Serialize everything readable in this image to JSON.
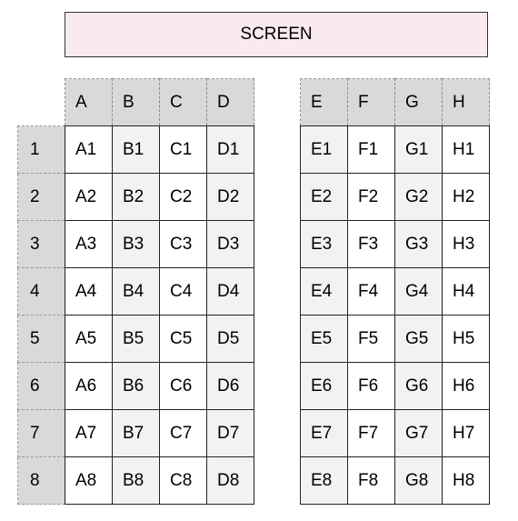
{
  "screen_label": "SCREEN",
  "rows": [
    "1",
    "2",
    "3",
    "4",
    "5",
    "6",
    "7",
    "8"
  ],
  "left_block": {
    "columns": [
      "A",
      "B",
      "C",
      "D"
    ],
    "seats": [
      [
        "A1",
        "B1",
        "C1",
        "D1"
      ],
      [
        "A2",
        "B2",
        "C2",
        "D2"
      ],
      [
        "A3",
        "B3",
        "C3",
        "D3"
      ],
      [
        "A4",
        "B4",
        "C4",
        "D4"
      ],
      [
        "A5",
        "B5",
        "C5",
        "D5"
      ],
      [
        "A6",
        "B6",
        "C6",
        "D6"
      ],
      [
        "A7",
        "B7",
        "C7",
        "D7"
      ],
      [
        "A8",
        "B8",
        "C8",
        "D8"
      ]
    ]
  },
  "right_block": {
    "columns": [
      "E",
      "F",
      "G",
      "H"
    ],
    "seats": [
      [
        "E1",
        "F1",
        "G1",
        "H1"
      ],
      [
        "E2",
        "F2",
        "G2",
        "H2"
      ],
      [
        "E3",
        "F3",
        "G3",
        "H3"
      ],
      [
        "E4",
        "F4",
        "G4",
        "H4"
      ],
      [
        "E5",
        "F5",
        "G5",
        "H5"
      ],
      [
        "E6",
        "F6",
        "G6",
        "H6"
      ],
      [
        "E7",
        "F7",
        "G7",
        "H7"
      ],
      [
        "E8",
        "F8",
        "G8",
        "H8"
      ]
    ]
  }
}
